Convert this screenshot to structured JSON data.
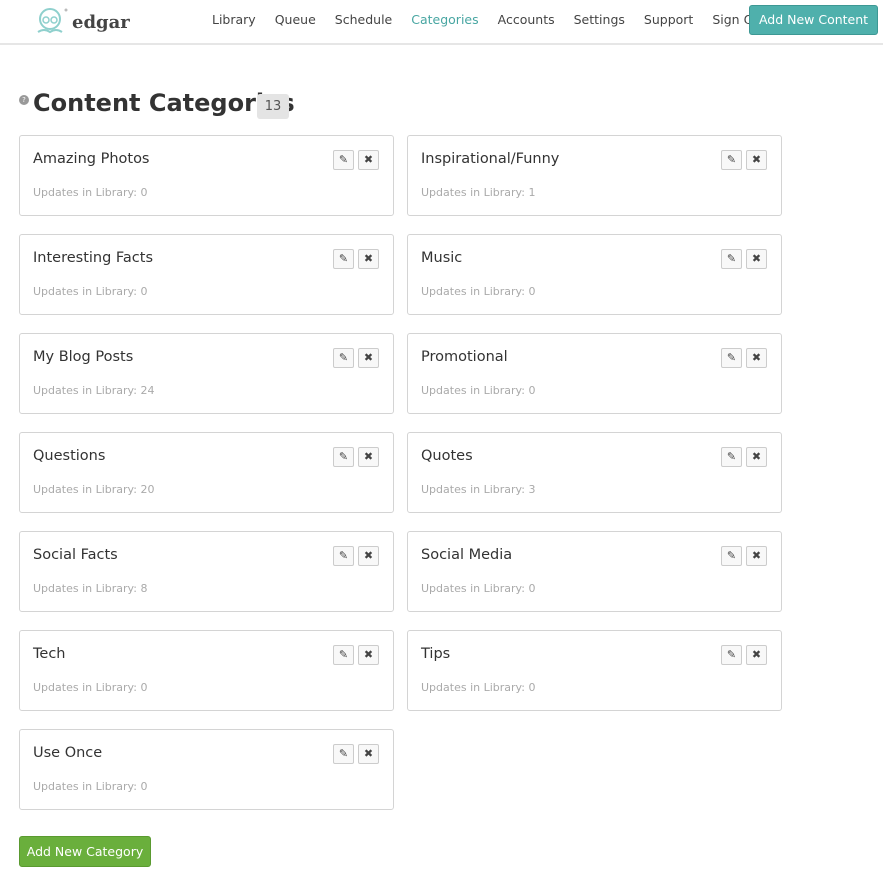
{
  "brand": {
    "name": "edgar",
    "accent": "#4fb0ac"
  },
  "nav": {
    "items": [
      {
        "label": "Library"
      },
      {
        "label": "Queue"
      },
      {
        "label": "Schedule"
      },
      {
        "label": "Categories",
        "active": true
      },
      {
        "label": "Accounts"
      },
      {
        "label": "Settings"
      },
      {
        "label": "Support"
      },
      {
        "label": "Sign Out"
      }
    ],
    "cta": "Add New Content"
  },
  "page": {
    "title": "Content Categories",
    "count": "13",
    "help_icon": "?"
  },
  "categories": [
    {
      "name": "Amazing Photos",
      "updates": "Updates in Library: 0"
    },
    {
      "name": "Inspirational/Funny",
      "updates": "Updates in Library: 1"
    },
    {
      "name": "Interesting Facts",
      "updates": "Updates in Library: 0"
    },
    {
      "name": "Music",
      "updates": "Updates in Library: 0"
    },
    {
      "name": "My Blog Posts",
      "updates": "Updates in Library: 24"
    },
    {
      "name": "Promotional",
      "updates": "Updates in Library: 0"
    },
    {
      "name": "Questions",
      "updates": "Updates in Library: 20"
    },
    {
      "name": "Quotes",
      "updates": "Updates in Library: 3"
    },
    {
      "name": "Social Facts",
      "updates": "Updates in Library: 8"
    },
    {
      "name": "Social Media",
      "updates": "Updates in Library: 0"
    },
    {
      "name": "Tech",
      "updates": "Updates in Library: 0"
    },
    {
      "name": "Tips",
      "updates": "Updates in Library: 0"
    },
    {
      "name": "Use Once",
      "updates": "Updates in Library: 0"
    }
  ],
  "icons": {
    "edit": "✎",
    "delete": "✖"
  },
  "add_category_label": "Add New Category"
}
